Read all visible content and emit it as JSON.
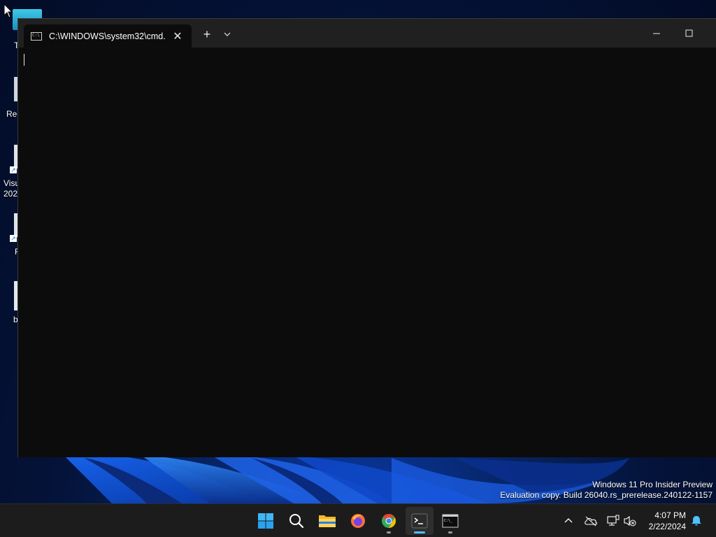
{
  "window": {
    "tab_title": "C:\\WINDOWS\\system32\\cmd.",
    "tab_icon_text": "C:\\",
    "new_tab_symbol": "+"
  },
  "desktop_icons": [
    {
      "label": "T",
      "icon": "folder-icon"
    },
    {
      "label": "Rec",
      "icon": "recycle-bin-icon"
    },
    {
      "label": "Visu\n202",
      "icon": "visual-studio-shortcut-icon"
    },
    {
      "label": "F",
      "icon": "shortcut-icon"
    },
    {
      "label": "b",
      "icon": "file-icon"
    }
  ],
  "watermark": {
    "line1": "Windows 11 Pro Insider Preview",
    "line2": "Evaluation copy. Build 26040.rs_prerelease.240122-1157"
  },
  "taskbar": {
    "items": [
      {
        "name": "start-button",
        "icon": "windows-logo-icon"
      },
      {
        "name": "search-button",
        "icon": "search-icon"
      },
      {
        "name": "file-explorer-button",
        "icon": "folder-icon"
      },
      {
        "name": "firefox-button",
        "icon": "firefox-icon"
      },
      {
        "name": "chrome-button",
        "icon": "chrome-icon"
      },
      {
        "name": "terminal-button",
        "icon": "terminal-icon"
      },
      {
        "name": "cmd-button",
        "icon": "cmd-icon"
      }
    ],
    "clock": {
      "time": "4:07 PM",
      "date": "2/22/2024"
    }
  },
  "colors": {
    "terminal_bg": "#0c0c0c",
    "titlebar_bg": "#202020",
    "taskbar_bg": "#1c1c1c",
    "accent": "#4cc2ff"
  }
}
